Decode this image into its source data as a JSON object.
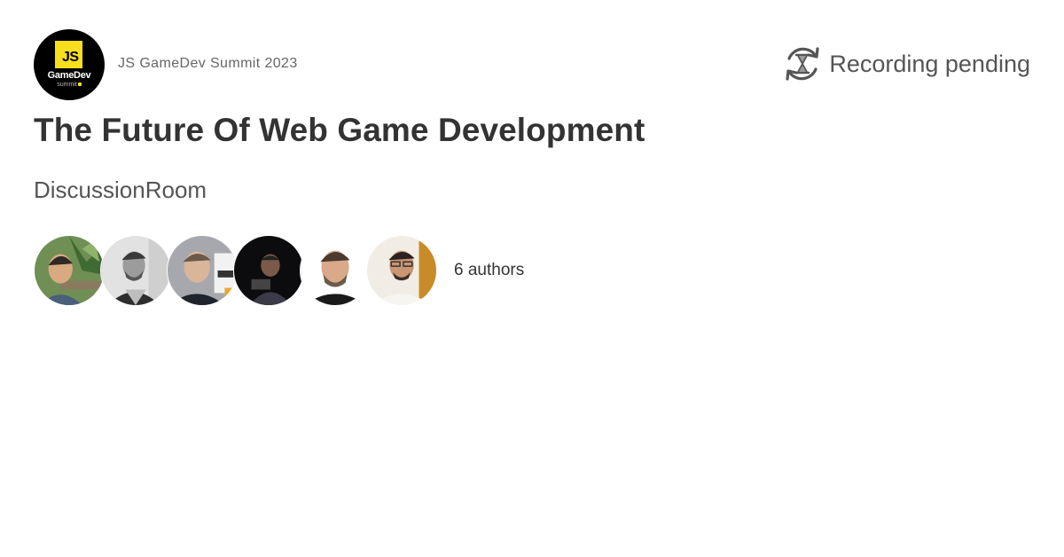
{
  "event": {
    "name": "JS GameDev Summit 2023",
    "logo": {
      "badge": "JS",
      "word": "GameDev",
      "sub": "summit"
    }
  },
  "recording": {
    "status": "Recording pending",
    "icon": "hourglass-refresh-icon"
  },
  "talk": {
    "title": "The Future Of Web Game Development",
    "type": "DiscussionRoom"
  },
  "authors": {
    "count_label": "6 authors",
    "avatars": [
      {
        "icon": "author-avatar-1"
      },
      {
        "icon": "author-avatar-2"
      },
      {
        "icon": "author-avatar-3"
      },
      {
        "icon": "author-avatar-4"
      },
      {
        "icon": "author-avatar-5"
      },
      {
        "icon": "author-avatar-6"
      }
    ]
  },
  "colors": {
    "title": "#333333",
    "muted": "#666666",
    "js_yellow": "#f7df1e",
    "background": "#ffffff"
  }
}
